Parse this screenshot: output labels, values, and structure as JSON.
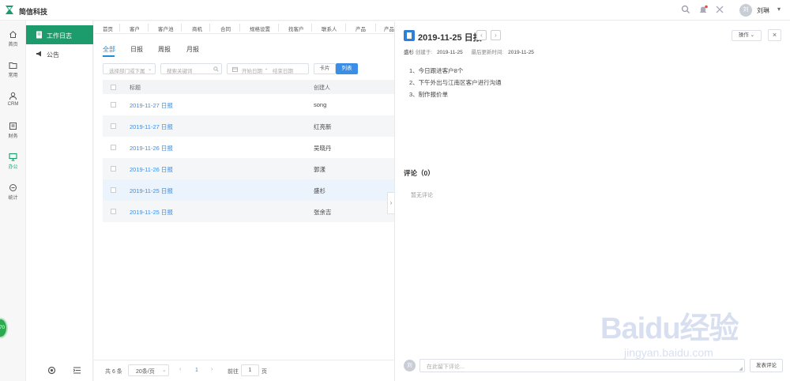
{
  "app": {
    "brand": "简信科技"
  },
  "header": {
    "user_initial": "刘",
    "user_name": "刘琳"
  },
  "leftnav": [
    {
      "label": "首页",
      "icon": "home-icon"
    },
    {
      "label": "常用",
      "icon": "folder-icon"
    },
    {
      "label": "CRM",
      "icon": "users-icon"
    },
    {
      "label": "财务",
      "icon": "finance-icon"
    },
    {
      "label": "办公",
      "icon": "monitor-icon",
      "active": true
    },
    {
      "label": "统计",
      "icon": "stats-icon"
    }
  ],
  "subnav": [
    {
      "label": "工作日志",
      "active": true
    },
    {
      "label": "公告"
    }
  ],
  "tabstrip": [
    "首页",
    "客户",
    "客户池",
    "商机",
    "合同",
    "规格设置",
    "找客户",
    "联系人",
    "产品",
    "产品"
  ],
  "report_tabs": [
    "全部",
    "日报",
    "周报",
    "月报"
  ],
  "filters": {
    "dept_placeholder": "选择部门或下属",
    "keyword_placeholder": "搜索关键词",
    "start_date": "开始日期",
    "date_sep": "-",
    "end_date": "结束日期",
    "card_label": "卡片",
    "list_label": "列表"
  },
  "table": {
    "columns": {
      "title": "标题",
      "creator": "创建人"
    },
    "rows": [
      {
        "title": "2019-11-27 日报",
        "creator": "song"
      },
      {
        "title": "2019-11-27 日报",
        "creator": "红亮新"
      },
      {
        "title": "2019-11-26 日报",
        "creator": "吴晓丹"
      },
      {
        "title": "2019-11-26 日报",
        "creator": "郭漾"
      },
      {
        "title": "2019-11-25 日报",
        "creator": "盛杉",
        "selected": true
      },
      {
        "title": "2019-11-25 日报",
        "creator": "张余吉"
      }
    ]
  },
  "pager": {
    "total": "共 6 条",
    "page_size": "20条/页",
    "current_page": "1",
    "goto_label": "前往",
    "goto_value": "1",
    "page_unit": "页"
  },
  "detail": {
    "title": "2019-11-25 日报",
    "operations_label": "操作",
    "creator_name": "盛杉",
    "created_label": "创建于:",
    "created_date": "2019-11-25",
    "updated_label": "最后更新时间:",
    "updated_date": "2019-11-25",
    "lines": [
      "1、今日跟进客户8个",
      "2、下午外出与江南区客户进行沟通",
      "3、制作报价单"
    ],
    "comments_title": "评论（0）",
    "no_comments": "暂无评论",
    "comment_avatar": "刘",
    "comment_placeholder": "在此留下评论...",
    "submit_label": "发表评论"
  },
  "watermark": {
    "brand": "Baidu经验",
    "url": "jingyan.baidu.com"
  },
  "float_badge": "70",
  "colors": {
    "brand_green": "#1c9c6c",
    "link_blue": "#3a8ee6",
    "accent_blue": "#2f7fd6"
  }
}
